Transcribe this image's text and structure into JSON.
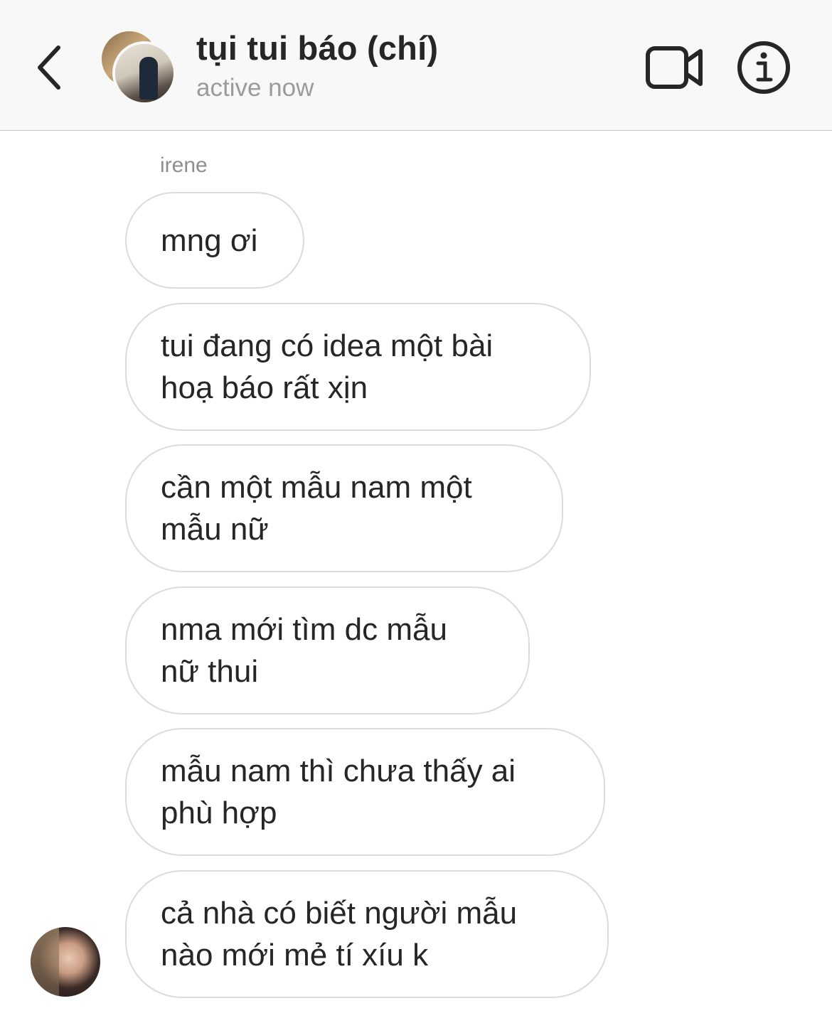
{
  "header": {
    "title": "tụi tui báo (chí)",
    "status": "active now",
    "icons": {
      "back": "chevron-left-icon",
      "video": "video-call-icon",
      "info": "info-icon"
    }
  },
  "conversation": {
    "sender": "irene",
    "messages": [
      {
        "lines": [
          "mng ơi"
        ]
      },
      {
        "lines": [
          "tui đang có idea một bài",
          "hoạ báo rất xịn"
        ]
      },
      {
        "lines": [
          "cần một mẫu nam một",
          "mẫu nữ"
        ]
      },
      {
        "lines": [
          "nma mới tìm dc mẫu",
          "nữ thui"
        ]
      },
      {
        "lines": [
          "mẫu nam thì chưa thấy ai",
          "phù hợp"
        ]
      },
      {
        "lines": [
          "cả nhà có biết người mẫu",
          "nào mới mẻ tí xíu k"
        ]
      }
    ]
  },
  "colors": {
    "header_bg": "#f8f8f8",
    "bubble_border": "#dbdbdb",
    "text": "#262626",
    "muted": "#8e8e8e"
  }
}
